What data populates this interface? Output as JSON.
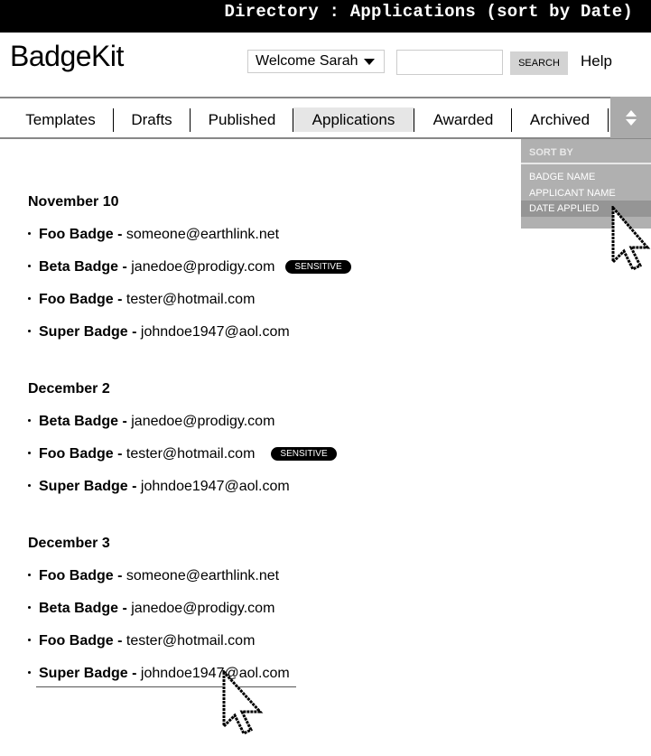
{
  "title_bar": "Directory : Applications (sort by Date)",
  "header": {
    "logo": "BadgeKit",
    "welcome_label": "Welcome Sarah",
    "search_value": "",
    "search_button": "SEARCH",
    "help": "Help"
  },
  "tabs": [
    {
      "label": "Templates",
      "active": false
    },
    {
      "label": "Drafts",
      "active": false
    },
    {
      "label": "Published",
      "active": false
    },
    {
      "label": "Applications",
      "active": true
    },
    {
      "label": "Awarded",
      "active": false
    },
    {
      "label": "Archived",
      "active": false
    }
  ],
  "sort_menu": {
    "heading": "SORT BY",
    "options": [
      "BADGE NAME",
      "APPLICANT NAME",
      "DATE APPLIED"
    ],
    "selected": "DATE APPLIED"
  },
  "groups": [
    {
      "date": "November 10",
      "items": [
        {
          "badge": "Foo Badge -",
          "email": "someone@earthlink.net",
          "tag": ""
        },
        {
          "badge": "Beta Badge -",
          "email": "janedoe@prodigy.com",
          "tag": "SENSITIVE"
        },
        {
          "badge": "Foo Badge -",
          "email": "tester@hotmail.com",
          "tag": ""
        },
        {
          "badge": "Super Badge -",
          "email": "johndoe1947@aol.com",
          "tag": ""
        }
      ]
    },
    {
      "date": "December 2",
      "items": [
        {
          "badge": "Beta Badge -",
          "email": "janedoe@prodigy.com",
          "tag": ""
        },
        {
          "badge": "Foo Badge -",
          "email": "tester@hotmail.com",
          "tag": "SENSITIVE"
        },
        {
          "badge": "Super Badge -",
          "email": "johndoe1947@aol.com",
          "tag": ""
        }
      ]
    },
    {
      "date": "December 3",
      "items": [
        {
          "badge": "Foo Badge -",
          "email": "someone@earthlink.net",
          "tag": ""
        },
        {
          "badge": "Beta Badge -",
          "email": "janedoe@prodigy.com",
          "tag": ""
        },
        {
          "badge": "Foo Badge -",
          "email": "tester@hotmail.com",
          "tag": ""
        },
        {
          "badge": "Super Badge -",
          "email": "johndoe1947@aol.com",
          "tag": ""
        }
      ]
    }
  ]
}
